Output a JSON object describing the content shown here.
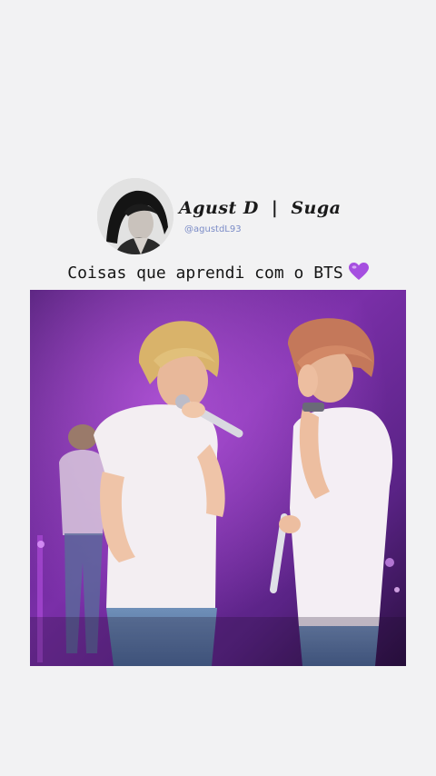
{
  "profile": {
    "display_name": "Agust D",
    "separator": "|",
    "alias": "Suga",
    "handle": "@agustdL93"
  },
  "caption": {
    "text": "Coisas que aprendi com o BTS",
    "emoji_icon": "purple-heart-icon"
  },
  "colors": {
    "background": "#f2f2f3",
    "heart": "#a64fe0",
    "handle": "#7b8cc7",
    "stage_purple": "#6a2a9a"
  }
}
